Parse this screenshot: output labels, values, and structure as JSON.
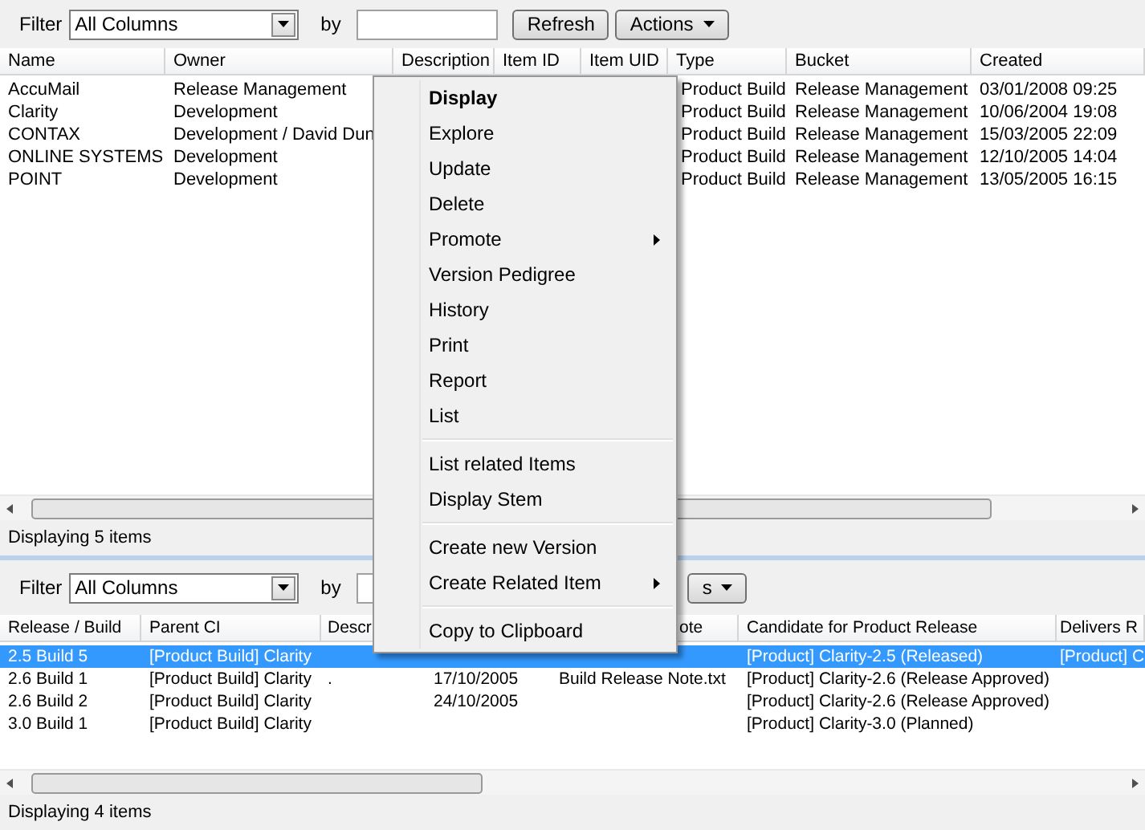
{
  "top_pane": {
    "filter": {
      "label": "Filter",
      "value": "All Columns",
      "by_label": "by"
    },
    "buttons": [
      {
        "label": "Refresh",
        "kind": "plain"
      },
      {
        "label": "Actions",
        "kind": "dropdown"
      }
    ],
    "table": {
      "columns": [
        "Name",
        "Owner",
        "Description",
        "Item ID",
        "Item UID",
        "Type",
        "Bucket",
        "Created"
      ],
      "rows": [
        {
          "selected": false,
          "cells": [
            "AccuMail",
            "Release Management",
            null,
            null,
            null,
            "Product Build",
            "Release Management",
            "03/01/2008 09:25"
          ]
        },
        {
          "selected": false,
          "cells": [
            "Clarity",
            "Development",
            null,
            null,
            null,
            "Product Build",
            "Release Management",
            "10/06/2004 19:08"
          ]
        },
        {
          "selected": false,
          "cells": [
            "CONTAX",
            "Development / David Dun",
            null,
            null,
            null,
            "Product Build",
            "Release Management",
            "15/03/2005 22:09"
          ]
        },
        {
          "selected": false,
          "cells": [
            "ONLINE SYSTEMS",
            "Development",
            null,
            null,
            null,
            "Product Build",
            "Release Management",
            "12/10/2005 14:04"
          ]
        },
        {
          "selected": false,
          "cells": [
            "POINT",
            "Development",
            null,
            null,
            null,
            "Product Build",
            "Release Management",
            "13/05/2005 16:15"
          ]
        }
      ]
    },
    "status": "Displaying 5 items"
  },
  "bottom_pane": {
    "filter": {
      "label": "Filter",
      "value": "All Columns",
      "by_label": "by"
    },
    "buttons": [
      {
        "label": "s",
        "kind": "dropdown"
      }
    ],
    "table": {
      "columns": [
        "Release / Build",
        "Parent CI",
        "Descr",
        null,
        "ote",
        "Candidate for Product Release",
        "Delivers R"
      ],
      "rows": [
        {
          "selected": true,
          "cells": [
            "2.5 Build 5",
            "[Product Build] Clarity",
            null,
            null,
            null,
            "[Product] Clarity-2.5 (Released)",
            "[Product] C"
          ]
        },
        {
          "selected": false,
          "cells": [
            "2.6 Build 1",
            "[Product Build] Clarity",
            ".",
            "17/10/2005",
            "Build Release Note.txt",
            "[Product] Clarity-2.6 (Release Approved)",
            null
          ]
        },
        {
          "selected": false,
          "cells": [
            "2.6 Build 2",
            "[Product Build] Clarity",
            null,
            "24/10/2005",
            null,
            "[Product] Clarity-2.6 (Release Approved)",
            null
          ]
        },
        {
          "selected": false,
          "cells": [
            "3.0 Build 1",
            "[Product Build] Clarity",
            null,
            null,
            null,
            "[Product] Clarity-3.0 (Planned)",
            null
          ]
        }
      ]
    },
    "status": "Displaying 4 items"
  },
  "context_menu": {
    "items": [
      {
        "kind": "item",
        "label": "Display",
        "default": true,
        "submenu": false
      },
      {
        "kind": "item",
        "label": "Explore",
        "default": false,
        "submenu": false
      },
      {
        "kind": "item",
        "label": "Update",
        "default": false,
        "submenu": false
      },
      {
        "kind": "item",
        "label": "Delete",
        "default": false,
        "submenu": false
      },
      {
        "kind": "item",
        "label": "Promote",
        "default": false,
        "submenu": true
      },
      {
        "kind": "item",
        "label": "Version Pedigree",
        "default": false,
        "submenu": false
      },
      {
        "kind": "item",
        "label": "History",
        "default": false,
        "submenu": false
      },
      {
        "kind": "item",
        "label": "Print",
        "default": false,
        "submenu": false
      },
      {
        "kind": "item",
        "label": "Report",
        "default": false,
        "submenu": false
      },
      {
        "kind": "item",
        "label": "List",
        "default": false,
        "submenu": false
      },
      {
        "kind": "separator"
      },
      {
        "kind": "item",
        "label": "List related Items",
        "default": false,
        "submenu": false
      },
      {
        "kind": "item",
        "label": "Display Stem",
        "default": false,
        "submenu": false
      },
      {
        "kind": "separator"
      },
      {
        "kind": "item",
        "label": "Create new Version",
        "default": false,
        "submenu": false
      },
      {
        "kind": "item",
        "label": "Create Related Item",
        "default": false,
        "submenu": true
      },
      {
        "kind": "separator"
      },
      {
        "kind": "item",
        "label": "Copy to Clipboard",
        "default": false,
        "submenu": false
      }
    ]
  }
}
